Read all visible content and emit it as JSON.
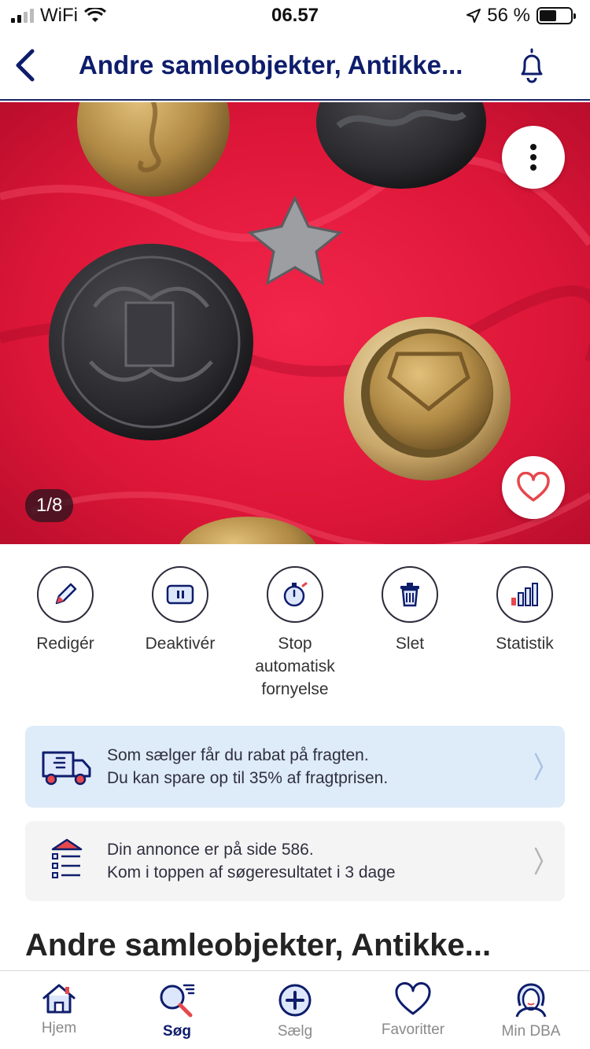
{
  "status_bar": {
    "carrier": "WiFi",
    "time": "06.57",
    "battery": "56 %"
  },
  "nav": {
    "title": "Andre samleobjekter, Antikke..."
  },
  "photo": {
    "counter": "1/8"
  },
  "actions": [
    {
      "label": "Redigér",
      "icon": "pencil-icon"
    },
    {
      "label": "Deaktivér",
      "icon": "pause-icon"
    },
    {
      "label": "Stop automatisk fornyelse",
      "icon": "stopwatch-icon"
    },
    {
      "label": "Slet",
      "icon": "trash-icon"
    },
    {
      "label": "Statistik",
      "icon": "bar-chart-icon"
    }
  ],
  "shipping_card": {
    "line1": "Som sælger får du rabat på fragten.",
    "line2": "Du kan spare op til 35% af fragtprisen."
  },
  "position_card": {
    "line1": "Din annonce er på side 586.",
    "line2": "Kom i toppen af søgeresultatet i 3 dage"
  },
  "listing_title": "Andre samleobjekter, Antikke...",
  "tabs": [
    {
      "label": "Hjem",
      "icon": "home-icon"
    },
    {
      "label": "Søg",
      "icon": "search-icon",
      "active": true
    },
    {
      "label": "Sælg",
      "icon": "plus-circle-icon"
    },
    {
      "label": "Favoritter",
      "icon": "heart-icon"
    },
    {
      "label": "Min DBA",
      "icon": "profile-icon"
    }
  ],
  "colors": {
    "brand_navy": "#0e1d6b",
    "accent_red": "#e5484d",
    "card_blue": "#deebf9",
    "card_gray": "#f4f4f5"
  }
}
